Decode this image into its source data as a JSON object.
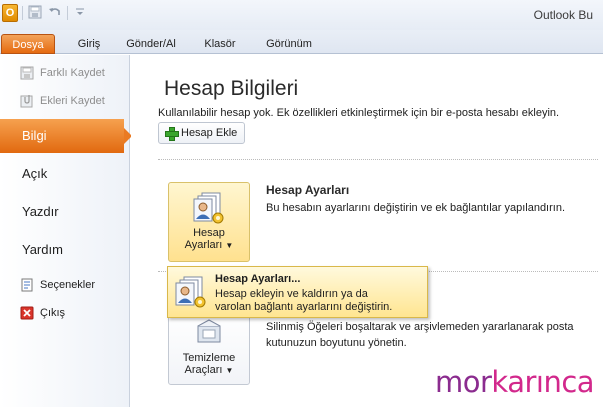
{
  "window": {
    "title": "Outlook Bu"
  },
  "quick_access": {
    "app_icon_letter": "O"
  },
  "ribbon": {
    "tabs": [
      {
        "label": "Dosya"
      },
      {
        "label": "Giriş"
      },
      {
        "label": "Gönder/Al"
      },
      {
        "label": "Klasör"
      },
      {
        "label": "Görünüm"
      }
    ]
  },
  "nav": {
    "save_as": "Farklı Kaydet",
    "save_attachments": "Ekleri Kaydet",
    "info": "Bilgi",
    "open": "Açık",
    "print": "Yazdır",
    "help": "Yardım",
    "options": "Seçenekler",
    "exit": "Çıkış"
  },
  "main": {
    "title": "Hesap Bilgileri",
    "description": "Kullanılabilir hesap yok. Ek özellikleri etkinleştirmek için bir e-posta hesabı ekleyin.",
    "add_account_label": "Hesap Ekle",
    "account_settings": {
      "button_line1": "Hesap",
      "button_line2": "Ayarları",
      "title": "Hesap Ayarları",
      "description": "Bu hesabın ayarlarını değiştirin ve ek bağlantılar yapılandırın."
    },
    "cleanup": {
      "button_line1": "Temizleme",
      "button_line2": "Araçları",
      "description_line1": "Silinmiş Öğeleri boşaltarak ve arşivlemeden yararlanarak posta",
      "description_line2": "kutunuzun boyutunu yönetin."
    }
  },
  "dropdown": {
    "title": "Hesap Ayarları...",
    "description_line1": "Hesap ekleyin ve kaldırın ya da",
    "description_line2": "varolan bağlantı ayarlarını değiştirin."
  },
  "watermark": {
    "part1": "mor",
    "part2": "karınca"
  },
  "colors": {
    "accent_orange": "#e56a10",
    "highlight_yellow": "#ffe18f",
    "logo_purple": "#8b2c8f",
    "logo_magenta": "#d2288c"
  }
}
